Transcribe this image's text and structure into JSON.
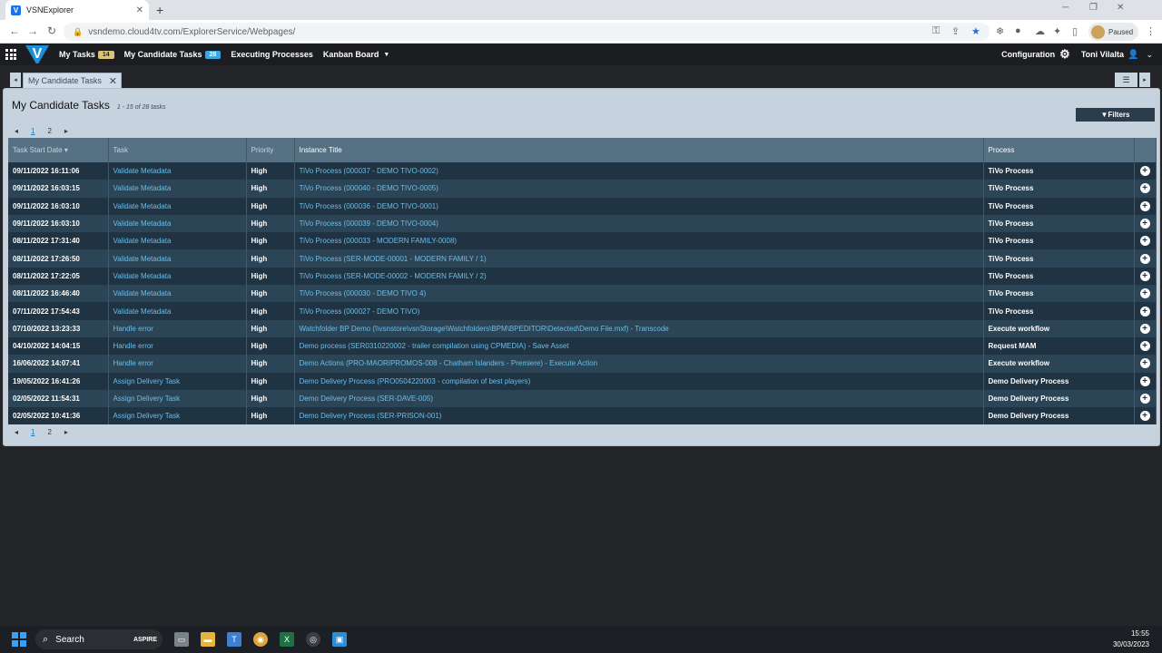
{
  "browser": {
    "tab_title": "VSNExplorer",
    "url": "vsndemo.cloud4tv.com/ExplorerService/Webpages/",
    "profile_status": "Paused"
  },
  "app": {
    "logo": "V",
    "nav": {
      "my_tasks": "My Tasks",
      "my_tasks_count": "14",
      "my_candidate_tasks": "My Candidate Tasks",
      "my_candidate_tasks_count": "28",
      "executing_processes": "Executing Processes",
      "kanban_board": "Kanban Board"
    },
    "configuration": "Configuration",
    "user": "Toni Vilalta"
  },
  "page_tab": {
    "label": "My Candidate Tasks"
  },
  "panel": {
    "title": "My Candidate Tasks",
    "count": "1 - 15 of 28 tasks",
    "filters": "Filters",
    "pages": [
      "1",
      "2"
    ]
  },
  "table": {
    "headers": {
      "date": "Task Start Date ▾",
      "task": "Task",
      "priority": "Priority",
      "instance": "Instance Title",
      "process": "Process"
    },
    "rows": [
      {
        "date": "09/11/2022 16:11:06",
        "task": "Validate Metadata",
        "priority": "High",
        "instance": "TiVo Process (000037 - DEMO TIVO-0002)",
        "process": "TiVo Process"
      },
      {
        "date": "09/11/2022 16:03:15",
        "task": "Validate Metadata",
        "priority": "High",
        "instance": "TiVo Process (000040 - DEMO TIVO-0005)",
        "process": "TiVo Process"
      },
      {
        "date": "09/11/2022 16:03:10",
        "task": "Validate Metadata",
        "priority": "High",
        "instance": "TiVo Process (000036 - DEMO TIVO-0001)",
        "process": "TiVo Process"
      },
      {
        "date": "09/11/2022 16:03:10",
        "task": "Validate Metadata",
        "priority": "High",
        "instance": "TiVo Process (000039 - DEMO TIVO-0004)",
        "process": "TiVo Process"
      },
      {
        "date": "08/11/2022 17:31:40",
        "task": "Validate Metadata",
        "priority": "High",
        "instance": "TiVo Process (000033 - MODERN FAMILY-0008)",
        "process": "TiVo Process"
      },
      {
        "date": "08/11/2022 17:26:50",
        "task": "Validate Metadata",
        "priority": "High",
        "instance": "TiVo Process (SER-MODE-00001 - MODERN FAMILY / 1)",
        "process": "TiVo Process"
      },
      {
        "date": "08/11/2022 17:22:05",
        "task": "Validate Metadata",
        "priority": "High",
        "instance": "TiVo Process (SER-MODE-00002 - MODERN FAMILY / 2)",
        "process": "TiVo Process"
      },
      {
        "date": "08/11/2022 16:46:40",
        "task": "Validate Metadata",
        "priority": "High",
        "instance": "TiVo Process (000030 - DEMO TIVO 4)",
        "process": "TiVo Process"
      },
      {
        "date": "07/11/2022 17:54:43",
        "task": "Validate Metadata",
        "priority": "High",
        "instance": "TiVo Process (000027 - DEMO TIVO)",
        "process": "TiVo Process"
      },
      {
        "date": "07/10/2022 13:23:33",
        "task": "Handle error",
        "priority": "High",
        "instance": "Watchfolder BP Demo (\\\\vsnstore\\vsnStorage\\Watchfolders\\BPM\\BPEDITOR\\Detected\\Demo File.mxf) - Transcode",
        "process": "Execute workflow"
      },
      {
        "date": "04/10/2022 14:04:15",
        "task": "Handle error",
        "priority": "High",
        "instance": "Demo process (SER0310220002 - trailer compilation using CPMEDIA) - Save Asset",
        "process": "Request MAM"
      },
      {
        "date": "16/06/2022 14:07:41",
        "task": "Handle error",
        "priority": "High",
        "instance": "Demo Actions (PRO-MAORIPROMOS-008 - Chatham Islanders - Premiere) - Execute Action",
        "process": "Execute workflow"
      },
      {
        "date": "19/05/2022 16:41:26",
        "task": "Assign Delivery Task",
        "priority": "High",
        "instance": "Demo Delivery Process (PRO0504220003 - compilation of best players)",
        "process": "Demo Delivery Process"
      },
      {
        "date": "02/05/2022 11:54:31",
        "task": "Assign Delivery Task",
        "priority": "High",
        "instance": "Demo Delivery Process (SER-DAVE-005)",
        "process": "Demo Delivery Process"
      },
      {
        "date": "02/05/2022 10:41:36",
        "task": "Assign Delivery Task",
        "priority": "High",
        "instance": "Demo Delivery Process (SER-PRISON-001)",
        "process": "Demo Delivery Process"
      }
    ]
  },
  "taskbar": {
    "search": "Search",
    "brand": "ASPIRE",
    "time": "15:55",
    "date": "30/03/2023"
  }
}
